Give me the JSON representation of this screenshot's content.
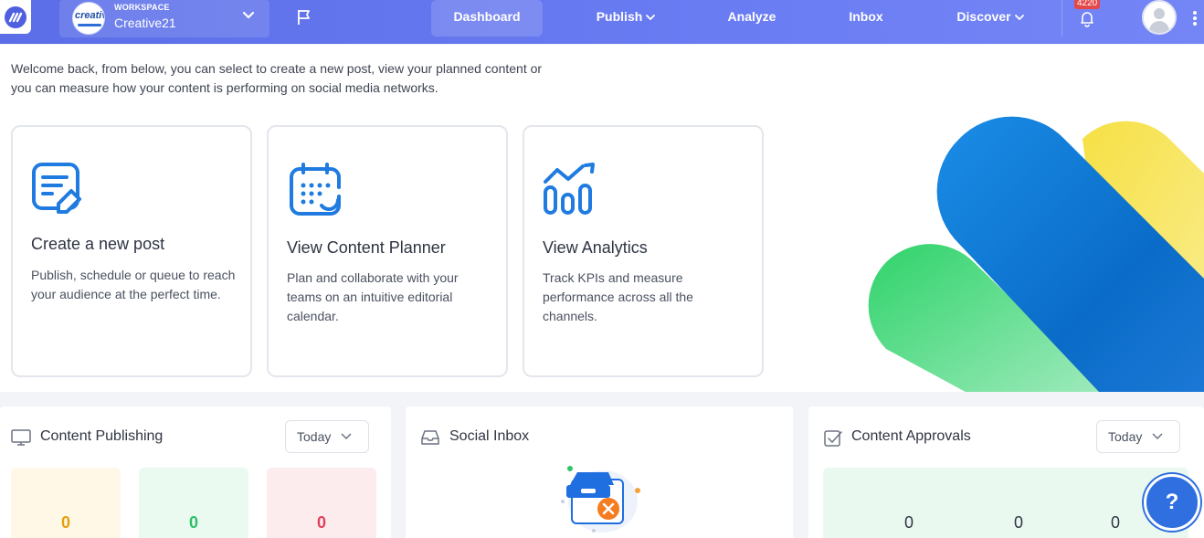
{
  "header": {
    "workspace_label": "WORKSPACE",
    "workspace_name": "Creative21",
    "workspace_logo_text": "creative",
    "nav": {
      "dashboard": "Dashboard",
      "publish": "Publish",
      "analyze": "Analyze",
      "inbox": "Inbox",
      "discover": "Discover"
    },
    "notification_count": "4220"
  },
  "welcome": {
    "text": "Welcome back, from below, you can select to create a new post, view your planned content or you can measure how your content is performing on social media networks."
  },
  "cards": [
    {
      "title": "Create a new post",
      "desc": "Publish, schedule or queue to reach your audience at the perfect time.",
      "icon": "edit-document-icon"
    },
    {
      "title": "View Content Planner",
      "desc": "Plan and collaborate with your teams on an intuitive editorial calendar.",
      "icon": "calendar-icon"
    },
    {
      "title": "View Analytics",
      "desc": "Track KPIs and measure performance across all the channels.",
      "icon": "analytics-icon"
    }
  ],
  "widgets": {
    "publishing": {
      "title": "Content Publishing",
      "range": "Today",
      "stats": [
        "0",
        "0",
        "0"
      ]
    },
    "inbox": {
      "title": "Social Inbox"
    },
    "approvals": {
      "title": "Content Approvals",
      "range": "Today",
      "stats": [
        "0",
        "0",
        "0"
      ]
    }
  },
  "help_label": "?",
  "colors": {
    "header_start": "#5b6ee8",
    "header_end": "#7486f6",
    "accent_blue": "#1f7be0",
    "stat_yellow": "#e5a00d",
    "stat_green": "#2cbf6a",
    "stat_red": "#e0425a"
  }
}
